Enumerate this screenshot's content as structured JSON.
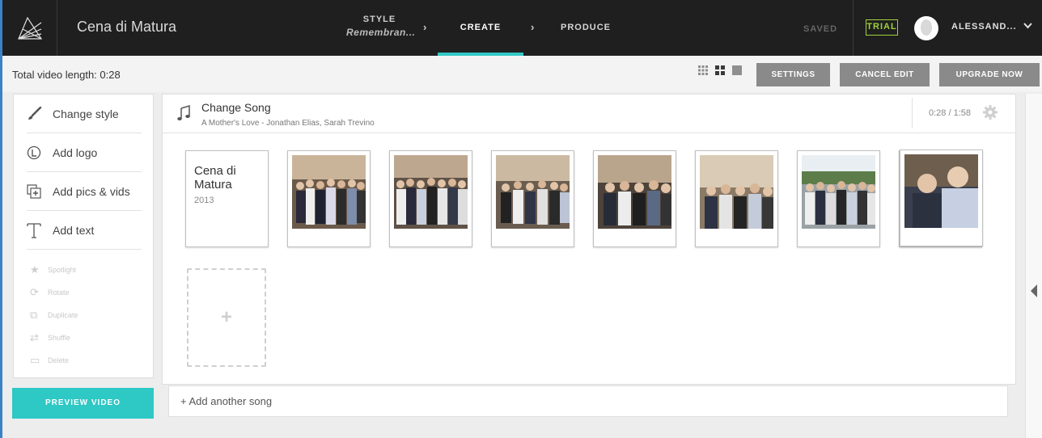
{
  "header": {
    "project_title": "Cena di Matura",
    "steps": [
      {
        "label": "STYLE",
        "sub": "Remembran..."
      },
      {
        "label": "CREATE"
      },
      {
        "label": "PRODUCE"
      }
    ],
    "saved": "SAVED",
    "trial": "TRIAL",
    "user": "ALESSAND...",
    "accent": "#33c7c4"
  },
  "toolbar": {
    "total_length": "Total video length: 0:28",
    "settings": "SETTINGS",
    "cancel_edit": "CANCEL EDIT",
    "upgrade_now": "UPGRADE NOW"
  },
  "tools": {
    "change_style": "Change style",
    "add_logo": "Add logo",
    "add_pics": "Add pics & vids",
    "add_text": "Add text",
    "spotlight": "Spotlight",
    "rotate": "Rotate",
    "duplicate": "Duplicate",
    "shuffle": "Shuffle",
    "delete": "Delete",
    "preview": "PREVIEW VIDEO"
  },
  "song": {
    "title": "Change Song",
    "artist": "A Mother's Love - Jonathan Elias, Sarah Trevino",
    "duration": "0:28 / 1:58",
    "add_another": "+ Add another song"
  },
  "title_card": {
    "title": "Cena di Matura",
    "year": "2013"
  },
  "photos": [
    "group-photo-1",
    "group-photo-2",
    "group-photo-3",
    "group-photo-4",
    "group-photo-5",
    "group-photo-6",
    "portrait-photo-7"
  ],
  "add_card_symbol": "+"
}
